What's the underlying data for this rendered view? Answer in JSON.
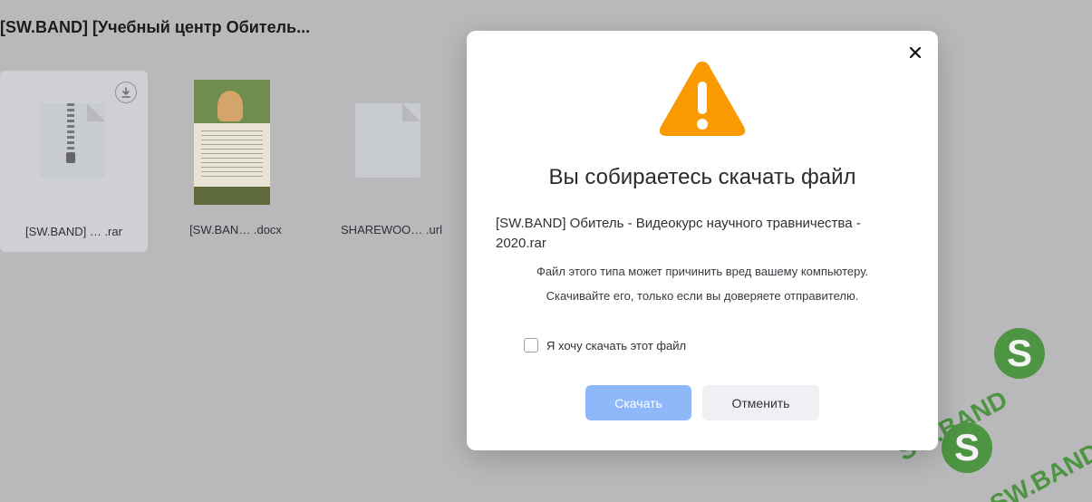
{
  "folder": {
    "title": "[SW.BAND] [Учебный центр Обитель..."
  },
  "files": [
    {
      "name": "[SW.BAND] …  .rar",
      "icon": "archive-file-icon"
    },
    {
      "name": "[SW.BAN…   .docx",
      "icon": "document-thumbnail"
    },
    {
      "name": "SHAREWOO…  .url",
      "icon": "generic-file-icon"
    }
  ],
  "dialog": {
    "title": "Вы собираетесь скачать файл",
    "file_name": "[SW.BAND] Обитель - Видеокурс научного травничества - 2020.rar",
    "warning_line1": "Файл этого типа может причинить вред вашему компьютеру.",
    "warning_line2": "Скачивайте его, только если вы доверяете отправителю.",
    "checkbox_label": "Я хочу скачать этот файл",
    "checkbox_checked": false,
    "download_label": "Скачать",
    "cancel_label": "Отменить"
  },
  "watermark": {
    "text": "SW.BAND",
    "logo": "S"
  },
  "colors": {
    "warning": "#f99b00",
    "primary_disabled": "#8fb8fb",
    "overlay": "#b9b9bb",
    "watermark_green": "#3b8f2d"
  },
  "icons": [
    "close-icon",
    "warning-icon",
    "download-icon",
    "archive-file-icon",
    "generic-file-icon"
  ]
}
